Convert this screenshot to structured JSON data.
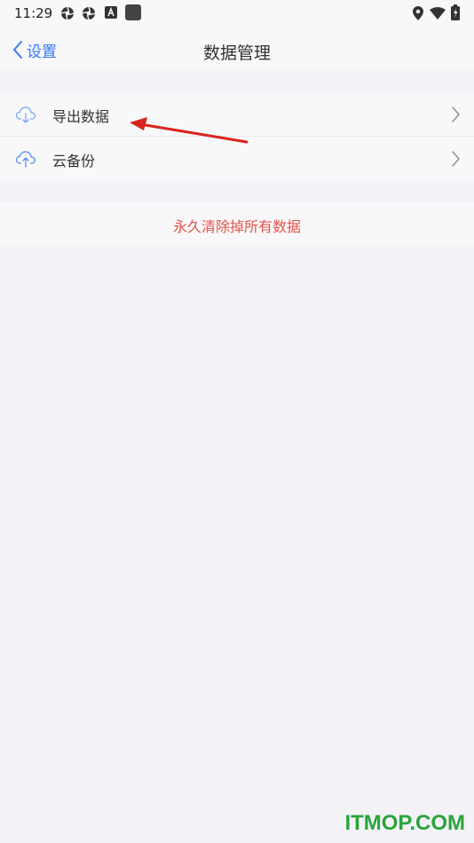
{
  "status_bar": {
    "time": "11:29",
    "left_icons": [
      "app-icon",
      "app-icon",
      "font-icon",
      "square-icon"
    ],
    "right_icons": [
      "location-icon",
      "wifi-icon",
      "battery-icon"
    ]
  },
  "nav": {
    "back_label": "设置",
    "title": "数据管理"
  },
  "rows": [
    {
      "icon": "cloud-download-icon",
      "label": "导出数据"
    },
    {
      "icon": "cloud-upload-icon",
      "label": "云备份"
    }
  ],
  "danger": {
    "label": "永久清除掉所有数据",
    "color": "#e5534b"
  },
  "colors": {
    "accent": "#3478f6",
    "annotation_arrow": "#d9231c",
    "watermark": "#2aa43a"
  },
  "watermark": "ITMOP.COM"
}
